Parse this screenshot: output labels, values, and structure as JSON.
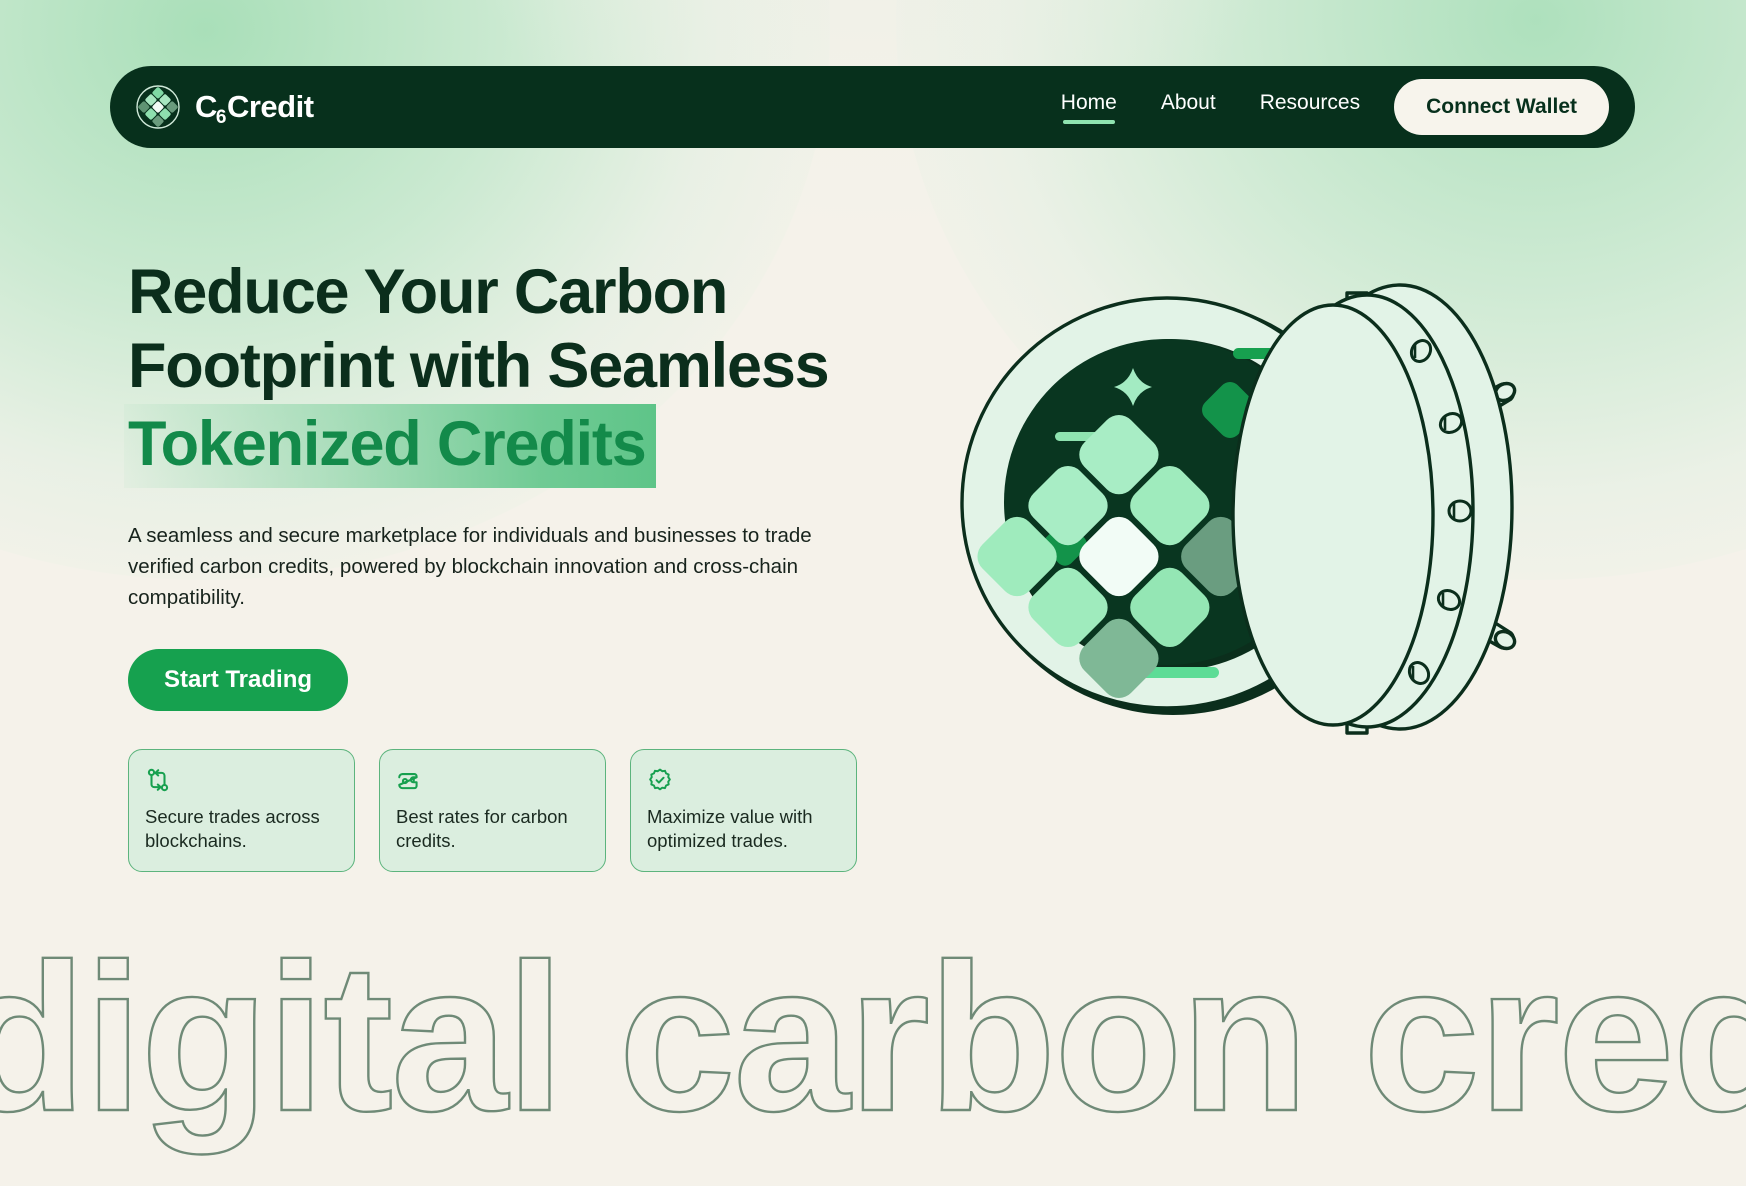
{
  "brand": {
    "name_prefix": "C",
    "name_sub": "6",
    "name_suffix": "Credit",
    "logo_icon": "diamond-grid-circle-icon"
  },
  "nav": {
    "links": [
      {
        "label": "Home",
        "active": true
      },
      {
        "label": "About",
        "active": false
      },
      {
        "label": "Resources",
        "active": false
      }
    ],
    "cta_label": "Connect Wallet"
  },
  "hero": {
    "headline_line1": "Reduce Your Carbon",
    "headline_line2": "Footprint with Seamless",
    "headline_line3_highlight": "Tokenized Credits",
    "subtext": "A seamless and secure marketplace for individuals and businesses to trade verified carbon credits, powered by blockchain innovation and cross-chain compatibility.",
    "cta_label": "Start Trading",
    "illustration": "open-vault-with-carbon-tokens-illustration"
  },
  "feature_cards": [
    {
      "icon": "cross-chain-swap-icon",
      "text": "Secure trades across blockchains."
    },
    {
      "icon": "banknote-wallet-icon",
      "text": "Best rates for carbon credits."
    },
    {
      "icon": "verified-badge-check-icon",
      "text": "Maximize value with optimized trades."
    }
  ],
  "marquee": {
    "text": "digital carbon credit"
  },
  "colors": {
    "page_background": "#f5f2ea",
    "navbar_dark": "#07301c",
    "brand_green": "#16a14f",
    "highlight_green": "#56c283",
    "accent_light_green": "#8fe3b0",
    "card_background": "#dbeedf",
    "card_border": "#5cb47d",
    "marquee_outline": "#6f8a77",
    "glow_green": "#a5deb6"
  }
}
